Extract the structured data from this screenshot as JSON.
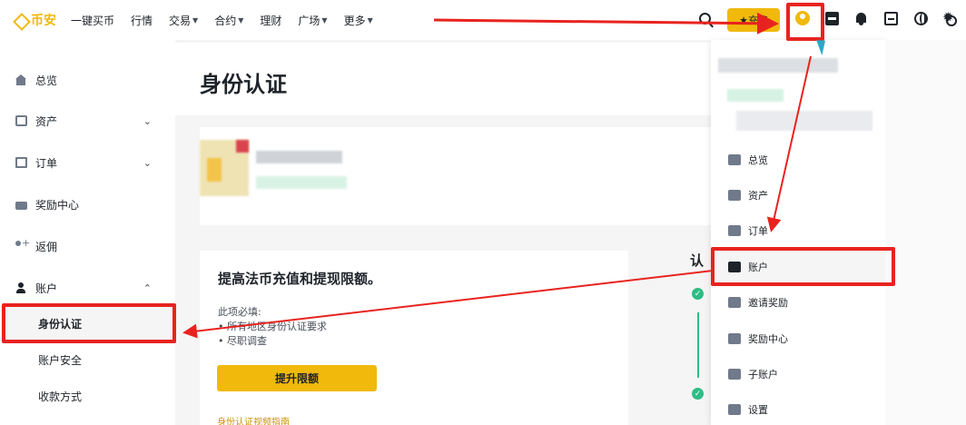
{
  "brand": {
    "name": "币安",
    "color": "#f0b90b"
  },
  "nav": {
    "items": [
      {
        "label": "一键买币",
        "has_caret": false
      },
      {
        "label": "行情",
        "has_caret": false
      },
      {
        "label": "交易",
        "has_caret": true
      },
      {
        "label": "合约",
        "has_caret": true
      },
      {
        "label": "理财",
        "has_caret": false
      },
      {
        "label": "广场",
        "has_caret": true
      },
      {
        "label": "更多",
        "has_caret": true
      }
    ],
    "deposit_label": "充值",
    "icons": [
      "search-icon",
      "user-icon",
      "wallet-icon",
      "bell-icon",
      "scan-icon",
      "globe-icon",
      "theme-icon"
    ]
  },
  "sidebar": {
    "items": [
      {
        "label": "总览",
        "icon": "home-icon"
      },
      {
        "label": "资产",
        "icon": "assets-icon",
        "chevron": "⌄"
      },
      {
        "label": "订单",
        "icon": "orders-icon",
        "chevron": "⌄"
      },
      {
        "label": "奖励中心",
        "icon": "reward-icon"
      },
      {
        "label": "返佣",
        "icon": "referral-icon"
      },
      {
        "label": "账户",
        "icon": "account-icon",
        "chevron": "⌃"
      }
    ],
    "sub_items": [
      {
        "label": "身份认证",
        "active": true
      },
      {
        "label": "账户安全",
        "active": false
      },
      {
        "label": "收款方式",
        "active": false
      }
    ]
  },
  "main": {
    "title": "身份认证",
    "limits": {
      "title": "提高法币充值和提现限额。",
      "required_label": "此项必填:",
      "requirements": [
        "所有地区身份认证要求",
        "尽职调查"
      ],
      "button": "提升限额",
      "guide_link": "身份认证视频指南"
    },
    "verify_heading": "认"
  },
  "dropdown": {
    "items": [
      {
        "label": "总览",
        "icon": "dashboard-icon"
      },
      {
        "label": "资产",
        "icon": "shield-icon"
      },
      {
        "label": "订单",
        "icon": "orders-icon"
      },
      {
        "label": "账户",
        "icon": "account-icon",
        "active": true
      },
      {
        "label": "邀请奖励",
        "icon": "invite-icon"
      },
      {
        "label": "奖励中心",
        "icon": "reward-icon"
      },
      {
        "label": "子账户",
        "icon": "sub-account-icon"
      },
      {
        "label": "设置",
        "icon": "settings-icon"
      }
    ]
  },
  "annotation_color": "#e8231f"
}
